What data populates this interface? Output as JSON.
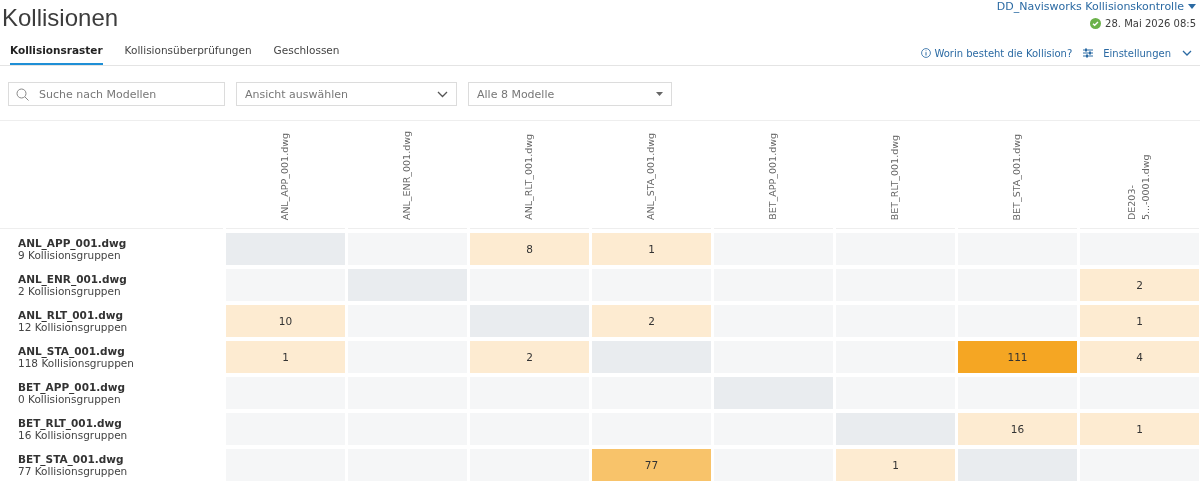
{
  "title": "Kollisionen",
  "project": {
    "name": "DD_Navisworks Kollisionskontrolle",
    "synced": true,
    "date": "28. Mai 2026 08:5"
  },
  "tabs": [
    {
      "label": "Kollisionsraster",
      "selected": true
    },
    {
      "label": "Kollisionsüberprüfungen",
      "selected": false
    },
    {
      "label": "Geschlossen",
      "selected": false
    }
  ],
  "help_link": "Worin besteht die Kollision?",
  "settings": "Einstellungen",
  "search": {
    "placeholder": "Suche nach Modellen"
  },
  "view_select": {
    "placeholder": "Ansicht auswählen"
  },
  "model_select": {
    "placeholder": "Alle 8 Modelle"
  },
  "columns": [
    "ANL_APP_001.dwg",
    "ANL_ENR_001.dwg",
    "ANL_RLT_001.dwg",
    "ANL_STA_001.dwg",
    "BET_APP_001.dwg",
    "BET_RLT_001.dwg",
    "BET_STA_001.dwg",
    "DE203-5...-0001.dwg"
  ],
  "rows": [
    {
      "name": "ANL_APP_001.dwg",
      "groups": "9 Kollisionsgruppen",
      "cells": [
        {
          "kind": "self"
        },
        {
          "kind": "empty"
        },
        {
          "kind": "count",
          "value": "8",
          "color": "#fdebd1"
        },
        {
          "kind": "count",
          "value": "1",
          "color": "#fdebd1"
        },
        {
          "kind": "empty"
        },
        {
          "kind": "empty"
        },
        {
          "kind": "empty"
        },
        {
          "kind": "empty"
        }
      ]
    },
    {
      "name": "ANL_ENR_001.dwg",
      "groups": "2 Kollisionsgruppen",
      "cells": [
        {
          "kind": "empty"
        },
        {
          "kind": "self"
        },
        {
          "kind": "empty"
        },
        {
          "kind": "empty"
        },
        {
          "kind": "empty"
        },
        {
          "kind": "empty"
        },
        {
          "kind": "empty"
        },
        {
          "kind": "count",
          "value": "2",
          "color": "#fdebd1"
        }
      ]
    },
    {
      "name": "ANL_RLT_001.dwg",
      "groups": "12 Kollisionsgruppen",
      "cells": [
        {
          "kind": "count",
          "value": "10",
          "color": "#fdebd1"
        },
        {
          "kind": "empty"
        },
        {
          "kind": "self"
        },
        {
          "kind": "count",
          "value": "2",
          "color": "#fdebd1"
        },
        {
          "kind": "empty"
        },
        {
          "kind": "empty"
        },
        {
          "kind": "empty"
        },
        {
          "kind": "count",
          "value": "1",
          "color": "#fdebd1"
        }
      ]
    },
    {
      "name": "ANL_STA_001.dwg",
      "groups": "118 Kollisionsgruppen",
      "cells": [
        {
          "kind": "count",
          "value": "1",
          "color": "#fdebd1"
        },
        {
          "kind": "empty"
        },
        {
          "kind": "count",
          "value": "2",
          "color": "#fdebd1"
        },
        {
          "kind": "self"
        },
        {
          "kind": "empty"
        },
        {
          "kind": "empty"
        },
        {
          "kind": "count",
          "value": "111",
          "color": "#f5a623"
        },
        {
          "kind": "count",
          "value": "4",
          "color": "#fdebd1"
        }
      ]
    },
    {
      "name": "BET_APP_001.dwg",
      "groups": "0 Kollisionsgruppen",
      "cells": [
        {
          "kind": "empty"
        },
        {
          "kind": "empty"
        },
        {
          "kind": "empty"
        },
        {
          "kind": "empty"
        },
        {
          "kind": "self"
        },
        {
          "kind": "empty"
        },
        {
          "kind": "empty"
        },
        {
          "kind": "empty"
        }
      ]
    },
    {
      "name": "BET_RLT_001.dwg",
      "groups": "16 Kollisionsgruppen",
      "cells": [
        {
          "kind": "empty"
        },
        {
          "kind": "empty"
        },
        {
          "kind": "empty"
        },
        {
          "kind": "empty"
        },
        {
          "kind": "empty"
        },
        {
          "kind": "self"
        },
        {
          "kind": "count",
          "value": "16",
          "color": "#fdebd1"
        },
        {
          "kind": "count",
          "value": "1",
          "color": "#fdebd1"
        }
      ]
    },
    {
      "name": "BET_STA_001.dwg",
      "groups": "77 Kollisionsgruppen",
      "cells": [
        {
          "kind": "empty"
        },
        {
          "kind": "empty"
        },
        {
          "kind": "empty"
        },
        {
          "kind": "count",
          "value": "77",
          "color": "#f8c36a"
        },
        {
          "kind": "empty"
        },
        {
          "kind": "count",
          "value": "1",
          "color": "#fdebd1"
        },
        {
          "kind": "self"
        },
        {
          "kind": "empty"
        }
      ]
    }
  ]
}
